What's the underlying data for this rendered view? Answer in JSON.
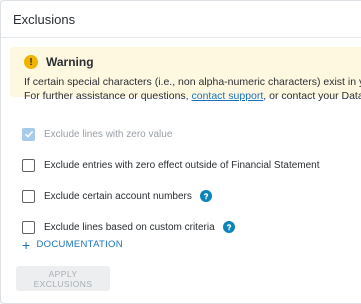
{
  "header": {
    "title": "Exclusions"
  },
  "warning": {
    "title": "Warning",
    "line1": "If certain special characters (i.e., non alpha-numeric characters) exist in your data se",
    "line2_before": "For further assistance or questions, ",
    "line2_link": "contact support",
    "line2_after": ", or contact your Data Analytics"
  },
  "options": [
    {
      "label": "Exclude lines with zero value",
      "checked": true,
      "disabled": true
    },
    {
      "label": "Exclude entries with zero effect outside of Financial Statement",
      "checked": false,
      "disabled": false
    },
    {
      "label": "Exclude certain account numbers",
      "checked": false,
      "disabled": false,
      "has_info": true
    },
    {
      "label": "Exclude lines based on custom criteria",
      "checked": false,
      "disabled": false,
      "has_info": true
    }
  ],
  "documentation": {
    "label": "DOCUMENTATION"
  },
  "apply_button": {
    "label": "APPLY EXCLUSIONS"
  },
  "colors": {
    "accent": "#1a73b9",
    "warning_bg": "#fff8e1",
    "warning_icon": "#f0b400",
    "info_icon": "#0b84b8"
  }
}
